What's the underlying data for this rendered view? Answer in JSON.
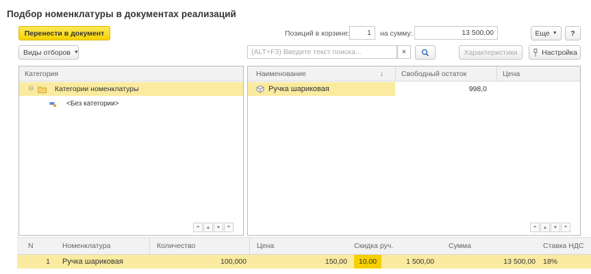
{
  "title": "Подбор номенклатуры в документах реализаций",
  "toolbar": {
    "transfer_label": "Перенести в документ",
    "positions_label": "Позиций в корзине:",
    "positions_value": "1",
    "sum_label": "на сумму:",
    "sum_value": "13 500,00",
    "more_label": "Еще",
    "help_label": "?"
  },
  "filters": {
    "filter_types_label": "Виды отборов",
    "search_placeholder": "(ALT+F3) Введите текст поиска...",
    "clear_glyph": "×",
    "characteristics_label": "Характеристики",
    "settings_label": "Настройка"
  },
  "categories": {
    "header": "Категория",
    "items": [
      {
        "label": "Категории номенклатуры",
        "icon": "folder-icon",
        "selected": true
      },
      {
        "label": "<Без категории>",
        "icon": "category-icon",
        "selected": false
      }
    ]
  },
  "products": {
    "columns": [
      "Наименование",
      "↓",
      "Свободный остаток",
      "Цена"
    ],
    "rows": [
      {
        "name": "Ручка шариковая",
        "stock": "998,0",
        "price": ""
      }
    ]
  },
  "cart": {
    "columns": [
      "N",
      "Номенклатура",
      "Количество",
      "Цена",
      "Скидка руч.",
      "Сумма",
      "Ставка НДС"
    ],
    "rows": [
      {
        "n": "1",
        "item": "Ручка шариковая",
        "qty": "100,000",
        "price": "150,00",
        "discount": "10,00",
        "discount_sum": "1 500,00",
        "sum": "13 500,00",
        "vat": "18%"
      }
    ]
  },
  "colors": {
    "accent_yellow": "#f7d100",
    "selection": "#faeba0"
  }
}
